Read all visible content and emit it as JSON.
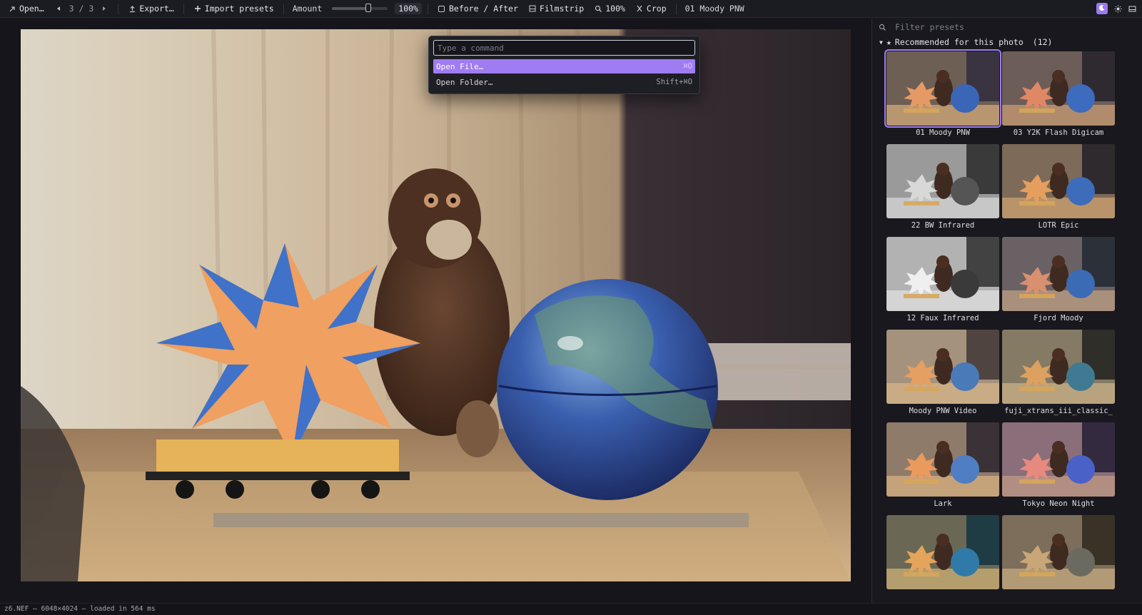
{
  "toolbar": {
    "open_label": "Open…",
    "nav_current": "3",
    "nav_sep": "/",
    "nav_total": "3",
    "export_label": "Export…",
    "import_label": "Import presets",
    "amount_label": "Amount",
    "amount_value": "100%",
    "amount_fraction": 0.65,
    "before_after_label": "Before / After",
    "filmstrip_label": "Filmstrip",
    "zoom_label": "100%",
    "crop_label": "Crop",
    "current_preset": "01 Moody PNW"
  },
  "palette": {
    "placeholder": "Type a command",
    "commands": [
      {
        "label": "Open File…",
        "shortcut": "⌘O"
      },
      {
        "label": "Open Folder…",
        "shortcut": "Shift+⌘O"
      }
    ]
  },
  "panel": {
    "filter_placeholder": "Filter presets",
    "section_title": "Recommended for this photo",
    "section_count": "(12)",
    "presets": [
      {
        "label": "01 Moody PNW",
        "tone": "moody"
      },
      {
        "label": "03 Y2K Flash Digicam",
        "tone": "cool"
      },
      {
        "label": "22 BW Infrared",
        "tone": "bw"
      },
      {
        "label": "LOTR Epic",
        "tone": "warm"
      },
      {
        "label": "12 Faux Infrared",
        "tone": "bw2"
      },
      {
        "label": "Fjord Moody",
        "tone": "fjord"
      },
      {
        "label": "Moody PNW Video",
        "tone": "video"
      },
      {
        "label": "fuji_xtrans_iii_classic_",
        "tone": "fuji"
      },
      {
        "label": "Lark",
        "tone": "lark"
      },
      {
        "label": "Tokyo Neon Night",
        "tone": "neon"
      },
      {
        "label": "",
        "tone": "teal"
      },
      {
        "label": "",
        "tone": "sepia"
      }
    ]
  },
  "status": {
    "text": "z6.NEF — 6048×4024 — loaded in 564 ms"
  },
  "colors": {
    "accent": "#a07cf2",
    "background": "#16161c",
    "panel": "#18181e"
  }
}
